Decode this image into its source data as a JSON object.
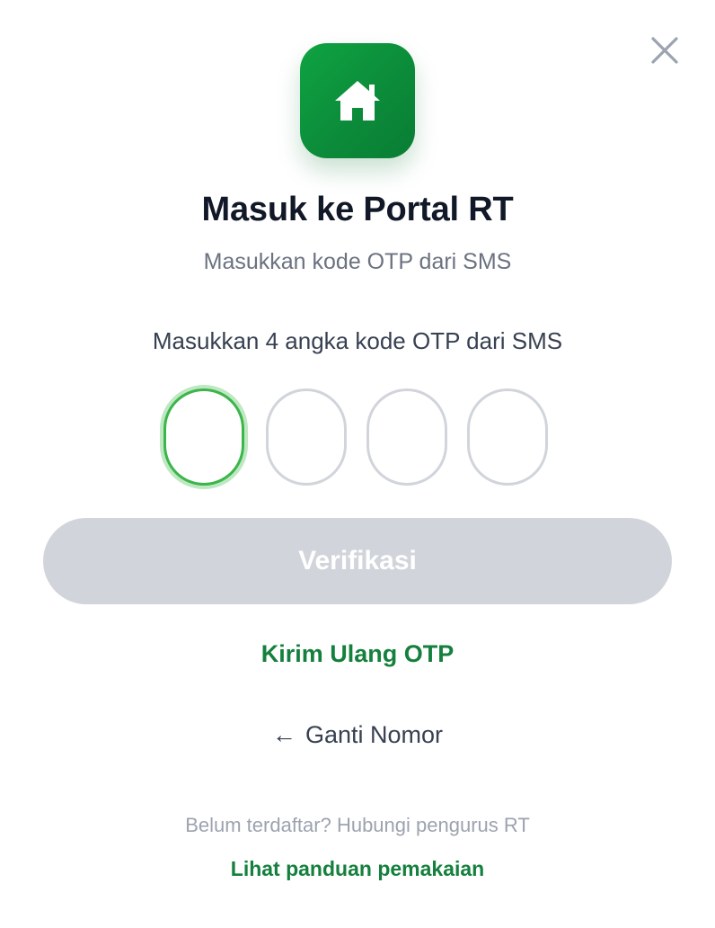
{
  "modal": {
    "title": "Masuk ke Portal RT",
    "subtitle": "Masukkan kode OTP dari SMS",
    "logo_icon": "house-icon",
    "close_icon": "close-icon"
  },
  "otp": {
    "label": "Masukkan 4 angka kode OTP dari SMS",
    "digits": [
      "",
      "",
      "",
      ""
    ],
    "active_index": 0
  },
  "actions": {
    "verify_label": "Verifikasi",
    "resend_label": "Kirim Ulang OTP",
    "change_number_arrow": "←",
    "change_number_label": "Ganti Nomor"
  },
  "footer": {
    "note": "Belum terdaftar? Hubungi pengurus RT",
    "guide_link": "Lihat panduan pemakaian"
  },
  "colors": {
    "brand_green": "#0fa342",
    "link_green": "#15803d",
    "active_border": "#3cb54a",
    "disabled_button": "#d1d5db"
  }
}
